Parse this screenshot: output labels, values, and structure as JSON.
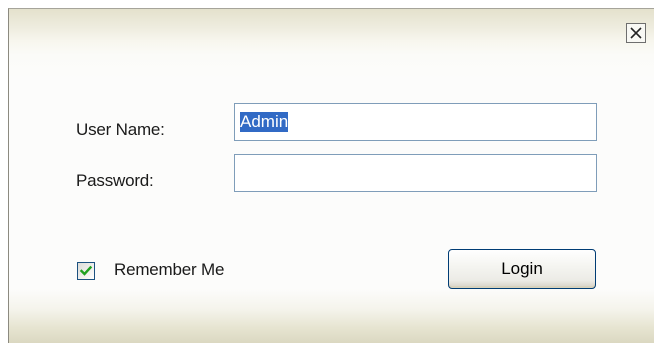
{
  "dialog": {
    "close_icon": "close-icon"
  },
  "form": {
    "username_label": "User Name:",
    "username_value": "Admin",
    "password_label": "Password:",
    "password_value": "",
    "remember_label": "Remember Me",
    "remember_checked": true,
    "login_label": "Login"
  },
  "colors": {
    "input_border": "#7f9db9",
    "selection": "#316ac5",
    "checkmark": "#21a121",
    "button_border": "#003c74"
  }
}
